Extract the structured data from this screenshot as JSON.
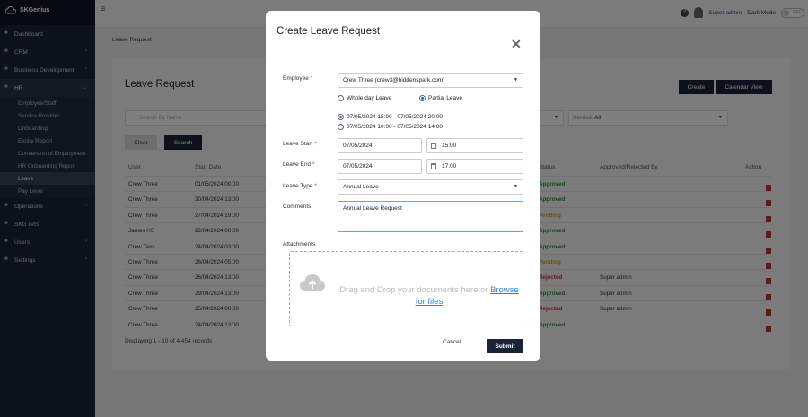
{
  "brand": "SKGenius",
  "topbar": {
    "user": "Super admin",
    "dark_mode": "Dark Mode",
    "toggle": "OFF"
  },
  "sidebar": {
    "items": [
      {
        "label": "Dashboard",
        "icon": "home-icon",
        "chev": ""
      },
      {
        "label": "CRM",
        "icon": "grid-icon",
        "chev": "›"
      },
      {
        "label": "Business Development",
        "icon": "folder-icon",
        "chev": "›"
      },
      {
        "label": "HR",
        "icon": "briefcase-icon",
        "chev": "⌄"
      }
    ],
    "hr_sub": [
      "Employee/Staff",
      "Service Provider",
      "Onboarding",
      "Expiry Report",
      "Conversion of Employment",
      "HR Onboarding Report",
      "Leave",
      "Pay Level"
    ],
    "items_after": [
      {
        "label": "Operations",
        "icon": "gear-icon",
        "chev": "›"
      },
      {
        "label": "SKG IMS",
        "icon": "box-icon",
        "chev": ""
      },
      {
        "label": "Users",
        "icon": "users-icon",
        "chev": "›"
      },
      {
        "label": "Settings",
        "icon": "cog-icon",
        "chev": "›"
      }
    ]
  },
  "page": {
    "breadcrumb": "Leave Request",
    "title": "Leave Request",
    "create": "Create",
    "calendar": "Calendar View",
    "search_placeholder": "Search By Name",
    "clear": "Clear",
    "search": "Search",
    "service_label": "Service:",
    "service_value": "All",
    "columns": {
      "user": "User",
      "start": "Start Date",
      "status": "Status",
      "approved": "Approved/Rejected By",
      "action": "Action"
    },
    "rows": [
      {
        "user": "Crew Three",
        "start": "01/05/2024 00:00",
        "status": "Approved",
        "color": "#1a9a2a",
        "by": "",
        "pending": false
      },
      {
        "user": "Crew Three",
        "start": "30/04/2024 13:00",
        "status": "Approved",
        "color": "#1a9a2a",
        "by": "",
        "pending": false
      },
      {
        "user": "Crew Three",
        "start": "27/04/2024 19:00",
        "status": "Pending",
        "color": "#d4a017",
        "by": "",
        "pending": true
      },
      {
        "user": "James HS",
        "start": "22/04/2024 00:00",
        "status": "Approved",
        "color": "#1a9a2a",
        "by": "",
        "pending": false
      },
      {
        "user": "Crew Two",
        "start": "24/04/2024 03:00",
        "status": "Approved",
        "color": "#1a9a2a",
        "by": "",
        "pending": false
      },
      {
        "user": "Crew Three",
        "start": "26/04/2024 05:00",
        "status": "Pending",
        "color": "#d4a017",
        "by": "",
        "pending": true
      },
      {
        "user": "Crew Three",
        "start": "26/04/2024 13:00",
        "status": "Rejected",
        "color": "#d62828",
        "by": "Super admin",
        "pending": false
      },
      {
        "user": "Crew Three",
        "start": "29/04/2024 13:00",
        "status": "Approved",
        "color": "#1a9a2a",
        "by": "Super admin",
        "pending": false
      },
      {
        "user": "Crew Three",
        "start": "25/04/2024 00:00",
        "status": "Rejected",
        "color": "#d62828",
        "by": "Super admin",
        "pending": false
      },
      {
        "user": "Crew Three",
        "start": "24/04/2024 13:00",
        "status": "Approved",
        "color": "#1a9a2a",
        "by": "",
        "pending": false
      }
    ],
    "footer": "Displaying 1 - 10 of 4,454 records"
  },
  "modal": {
    "title": "Create Leave Request",
    "close": "✕",
    "employee_label": "Employee",
    "employee_value": "Crew Three (crew3@hiddenspark.com)",
    "whole_day": "Whole day Leave",
    "partial": "Partial Leave",
    "slot1": "07/05/2024 15:00 - 07/05/2024 20:00",
    "slot2": "07/05/2024 10:00 - 07/05/2024 14:00",
    "leave_start_label": "Leave Start",
    "start_date": "07/05/2024",
    "start_time": "15:00",
    "leave_end_label": "Leave End",
    "end_date": "07/05/2024",
    "end_time": "17:00",
    "leave_type_label": "Leave Type",
    "leave_type_value": "Annual Leave",
    "comments_label": "Comments",
    "comments_value": "Annual Leave Request",
    "attachments_label": "Attachments",
    "drop_text": "Drag and Drop your documents here or",
    "browse": "Browse for files",
    "cancel": "Cancel",
    "submit": "Submit"
  },
  "colors": {
    "sidebar": "#1b2336",
    "approved": "#1a9a2a",
    "pending": "#d4a017",
    "rejected": "#d62828"
  }
}
